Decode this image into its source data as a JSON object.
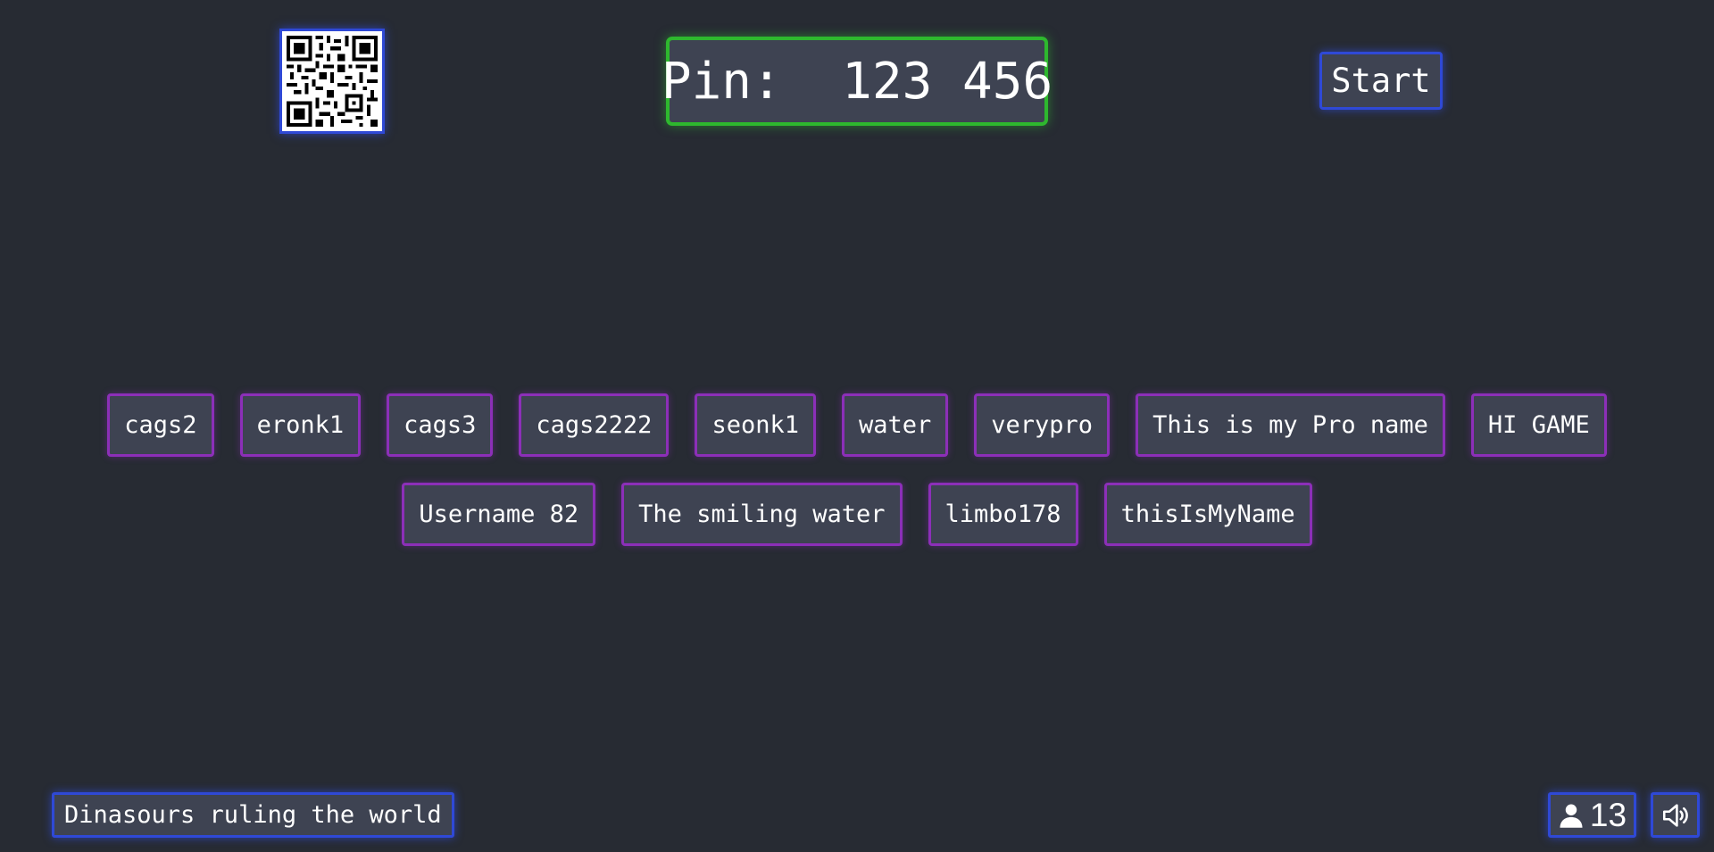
{
  "qr": {
    "icon": "qr-code-icon"
  },
  "pin": {
    "text": "Pin:  123 456"
  },
  "start_button": {
    "label": "Start"
  },
  "players": [
    "cags2",
    "eronk1",
    "cags3",
    "cags2222",
    "seonk1",
    "water",
    "verypro",
    "This is my Pro name",
    "HI GAME",
    "Username 82",
    "The smiling water",
    "limbo178",
    "thisIsMyName"
  ],
  "topic": {
    "text": "Dinasours ruling the world"
  },
  "player_count": {
    "icon": "person-icon",
    "value": "13"
  },
  "sound": {
    "icon": "speaker-icon"
  },
  "colors": {
    "background": "#272b33",
    "panel": "#3e4352",
    "pin_border": "#2eb82e",
    "button_border": "#2f49d6",
    "player_border": "#8c2fb8"
  }
}
